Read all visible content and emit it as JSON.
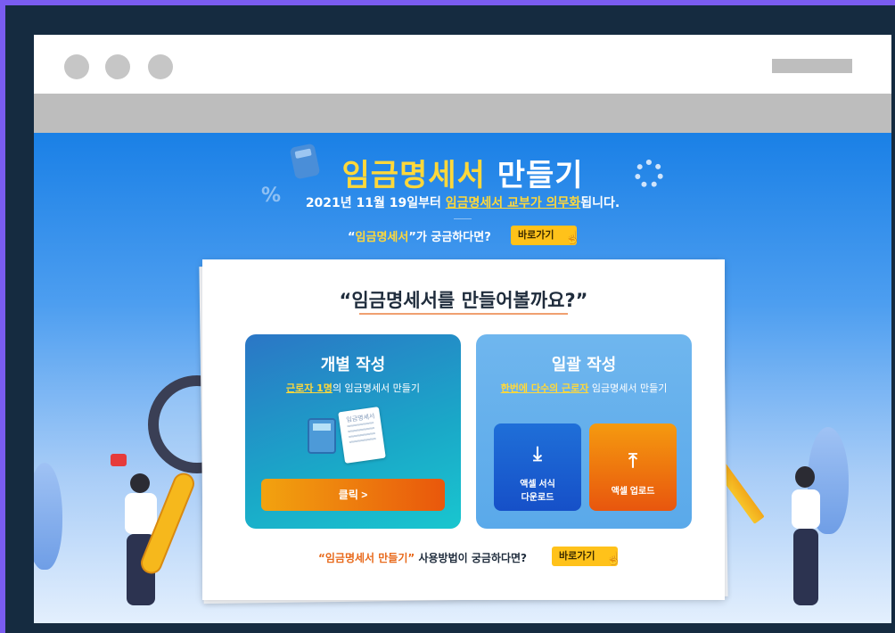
{
  "window": {
    "controls": [
      "close",
      "minimize",
      "maximize"
    ]
  },
  "hero": {
    "title_highlight": "임금명세서",
    "title_rest": " 만들기",
    "sub_date": "2021년 11월 19일",
    "sub_mid": "부터 ",
    "sub_underline": "임금명세서 교부가 의무화",
    "sub_end": "됩니다.",
    "question_open": "“",
    "question_keyword": "임금명세서",
    "question_rest": "”가  궁금하다면?",
    "go_label": "바로가기"
  },
  "paper": {
    "title": "“임금명세서를 만들어볼까요?”",
    "individual": {
      "title": "개별 작성",
      "desc_highlight": "근로자 1명",
      "desc_rest": "의 임금명세서 만들기",
      "doc_label": "임금명세서",
      "click_label": "클릭  >"
    },
    "bulk": {
      "title": "일괄 작성",
      "desc_highlight": "한번에 다수의 근로자",
      "desc_rest": " 임금명세서 만들기",
      "download_label": "액셀 서식\n다운로드",
      "upload_label": "액셀 업로드"
    },
    "bottom_keyword": "“임금명세서 만들기”",
    "bottom_rest": " 사용방법이 궁금하다면?",
    "bottom_go_label": "바로가기"
  },
  "icons": {
    "download": "download-icon",
    "upload": "upload-icon",
    "hand": "pointer-hand-icon"
  },
  "colors": {
    "accent_yellow": "#ffd83a",
    "button_yellow": "#ffc21a",
    "hero_blue": "#1a80e6",
    "orange": "#e9570c"
  }
}
